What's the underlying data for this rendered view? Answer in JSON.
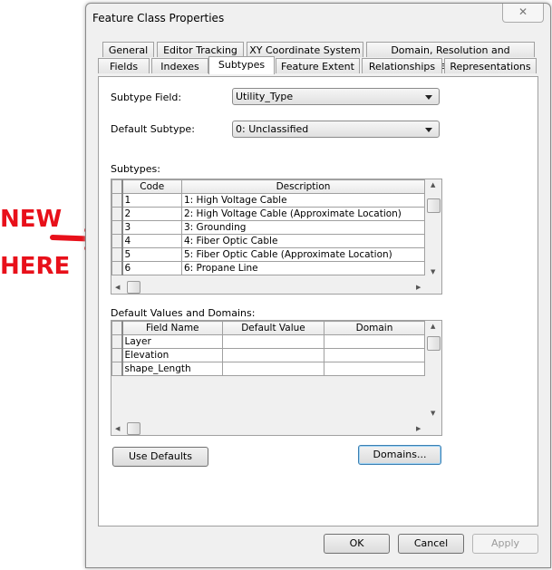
{
  "annotation": {
    "line1": "NEW",
    "line2": "HERE",
    "color": "#e8101a"
  },
  "dialog": {
    "title": "Feature Class Properties",
    "close_glyph": "✕"
  },
  "tabs_row1": [
    "General",
    "Editor Tracking",
    "XY Coordinate System",
    "Domain, Resolution and Tolerance"
  ],
  "tabs_row2": [
    "Fields",
    "Indexes",
    "Subtypes",
    "Feature Extent",
    "Relationships",
    "Representations"
  ],
  "active_tab": "Subtypes",
  "subtype_field": {
    "label": "Subtype Field:",
    "value": "Utility_Type"
  },
  "default_subtype": {
    "label": "Default Subtype:",
    "value": "0: Unclassified"
  },
  "subtypes": {
    "label": "Subtypes:",
    "columns": [
      "Code",
      "Description"
    ],
    "rows": [
      [
        "1",
        "1: High Voltage Cable"
      ],
      [
        "2",
        "2: High Voltage Cable (Approximate Location)"
      ],
      [
        "3",
        "3: Grounding"
      ],
      [
        "4",
        "4: Fiber Optic Cable"
      ],
      [
        "5",
        "5: Fiber Optic Cable (Approximate Location)"
      ],
      [
        "6",
        "6: Propane Line"
      ]
    ]
  },
  "defaults": {
    "label": "Default Values and Domains:",
    "columns": [
      "Field Name",
      "Default Value",
      "Domain"
    ],
    "rows": [
      [
        "Layer",
        "",
        ""
      ],
      [
        "Elevation",
        "",
        ""
      ],
      [
        "shape_Length",
        "",
        ""
      ]
    ]
  },
  "buttons": {
    "use_defaults": "Use Defaults",
    "domains": "Domains...",
    "ok": "OK",
    "cancel": "Cancel",
    "apply": "Apply"
  }
}
